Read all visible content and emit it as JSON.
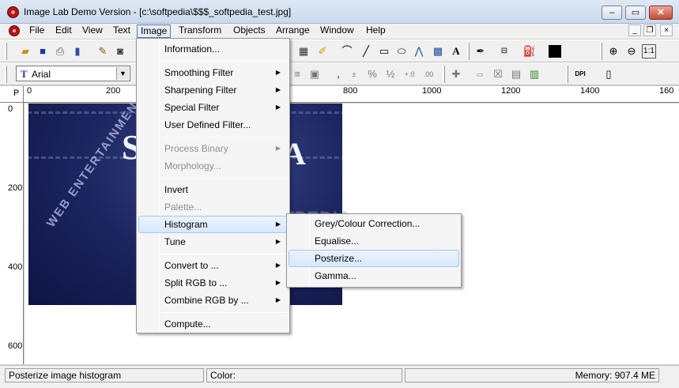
{
  "window": {
    "title": "Image Lab Demo Version - [c:\\softpedia\\$$$_softpedia_test.jpg]",
    "minimize": "–",
    "maximize": "▭",
    "close": "✕"
  },
  "menubar": {
    "items": [
      "File",
      "Edit",
      "View",
      "Text",
      "Image",
      "Transform",
      "Objects",
      "Arrange",
      "Window",
      "Help"
    ],
    "active": "Image",
    "mdi_controls": [
      "_",
      "❐",
      "×"
    ]
  },
  "toolbar2": {
    "font_name": "Arial",
    "font_type_glyph": "T"
  },
  "ruler": {
    "unit": "P",
    "top_labels": [
      "0",
      "200",
      "800",
      "1000",
      "1200",
      "1400",
      "160"
    ],
    "left_labels": [
      "0",
      "200",
      "400",
      "600"
    ]
  },
  "image_menu": {
    "items": [
      {
        "label": "Information...",
        "disabled": false,
        "submenu": false
      },
      {
        "label": "Smoothing Filter",
        "disabled": false,
        "submenu": true
      },
      {
        "label": "Sharpening Filter",
        "disabled": false,
        "submenu": true
      },
      {
        "label": "Special Filter",
        "disabled": false,
        "submenu": true
      },
      {
        "label": "User Defined Filter...",
        "disabled": false,
        "submenu": false
      },
      {
        "label": "Process Binary",
        "disabled": true,
        "submenu": true
      },
      {
        "label": "Morphology...",
        "disabled": true,
        "submenu": false
      },
      {
        "label": "Invert",
        "disabled": false,
        "submenu": false
      },
      {
        "label": "Palette...",
        "disabled": true,
        "submenu": false
      },
      {
        "label": "Histogram",
        "disabled": false,
        "submenu": true
      },
      {
        "label": "Tune",
        "disabled": false,
        "submenu": true
      },
      {
        "label": "Convert to ...",
        "disabled": false,
        "submenu": true
      },
      {
        "label": "Split RGB to ...",
        "disabled": false,
        "submenu": true
      },
      {
        "label": "Combine RGB by ...",
        "disabled": false,
        "submenu": true
      },
      {
        "label": "Compute...",
        "disabled": false,
        "submenu": false
      }
    ],
    "highlighted": "Histogram"
  },
  "histogram_submenu": {
    "items": [
      "Grey/Colour Correction...",
      "Equalise...",
      "Posterize...",
      "Gamma..."
    ],
    "highlighted": "Posterize..."
  },
  "photo": {
    "arc_text": "WEB ENTERTAINMENT",
    "letter_left": "S",
    "letter_right": "A"
  },
  "watermark": "SOFTPEDIA",
  "status": {
    "hint": "Posterize image histogram",
    "color_label": "Color:",
    "memory": "Memory: 907.4 ME"
  }
}
